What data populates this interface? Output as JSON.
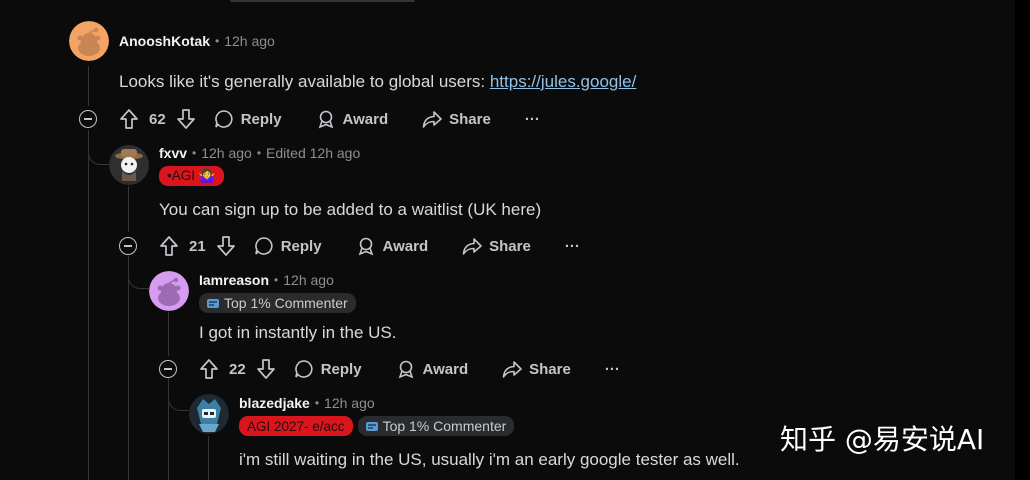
{
  "colors": {
    "background": "#0b0b0b",
    "link": "#8fc3ea",
    "flair_red": "#d9161e",
    "thread_line": "#343536"
  },
  "comments": [
    {
      "username": "AnooshKotak",
      "time": "12h ago",
      "body_prefix": "Looks like it's generally available to global users: ",
      "link_text": "https://jules.google/",
      "score": "62",
      "actions": {
        "reply": "Reply",
        "award": "Award",
        "share": "Share",
        "more": "···"
      }
    },
    {
      "username": "fxvv",
      "time": "12h ago",
      "edited": "Edited 12h ago",
      "flair_text": "•AGI 🤷‍♀️",
      "body": "You can sign up to be added to a waitlist (UK here)",
      "score": "21",
      "actions": {
        "reply": "Reply",
        "award": "Award",
        "share": "Share",
        "more": "···"
      }
    },
    {
      "username": "Iamreason",
      "time": "12h ago",
      "flair_text": "Top 1% Commenter",
      "body": "I got in instantly in the US.",
      "score": "22",
      "actions": {
        "reply": "Reply",
        "award": "Award",
        "share": "Share",
        "more": "···"
      }
    },
    {
      "username": "blazedjake",
      "time": "12h ago",
      "flair_red_text": "AGI 2027- e/acc",
      "flair_text": "Top 1% Commenter",
      "body": "i'm still waiting in the US, usually i'm an early google tester as well."
    }
  ],
  "watermark": "知乎 @易安说AI"
}
